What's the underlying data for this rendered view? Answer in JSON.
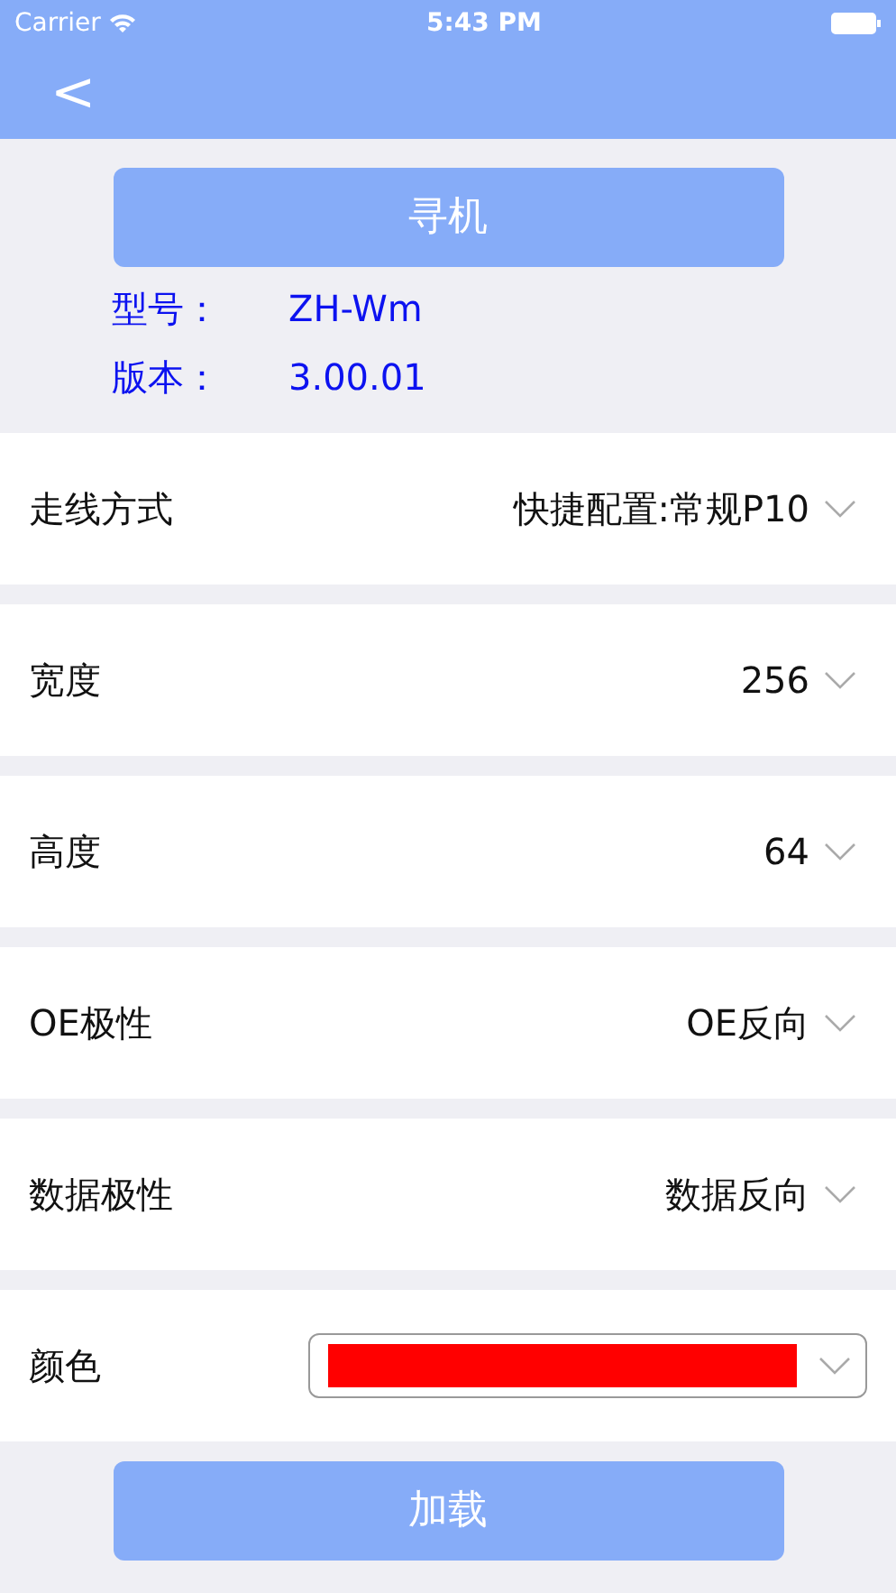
{
  "status_bar": {
    "carrier": "Carrier",
    "time": "5:43 PM"
  },
  "nav_bar": {
    "back": "<"
  },
  "search_button": "寻机",
  "device_info": [
    {
      "label": "型号：",
      "value": "ZH-Wm"
    },
    {
      "label": "版本：",
      "value": "3.00.01"
    }
  ],
  "settings": [
    {
      "kind": "select",
      "label": "走线方式",
      "value": "快捷配置:常规P10"
    },
    {
      "kind": "select",
      "label": "宽度",
      "value": "256"
    },
    {
      "kind": "select",
      "label": "高度",
      "value": "64"
    },
    {
      "kind": "select",
      "label": "OE极性",
      "value": "OE反向"
    },
    {
      "kind": "select",
      "label": "数据极性",
      "value": "数据反向"
    },
    {
      "kind": "color",
      "label": "颜色",
      "color": "#ff0000"
    }
  ],
  "load_button": "加载"
}
